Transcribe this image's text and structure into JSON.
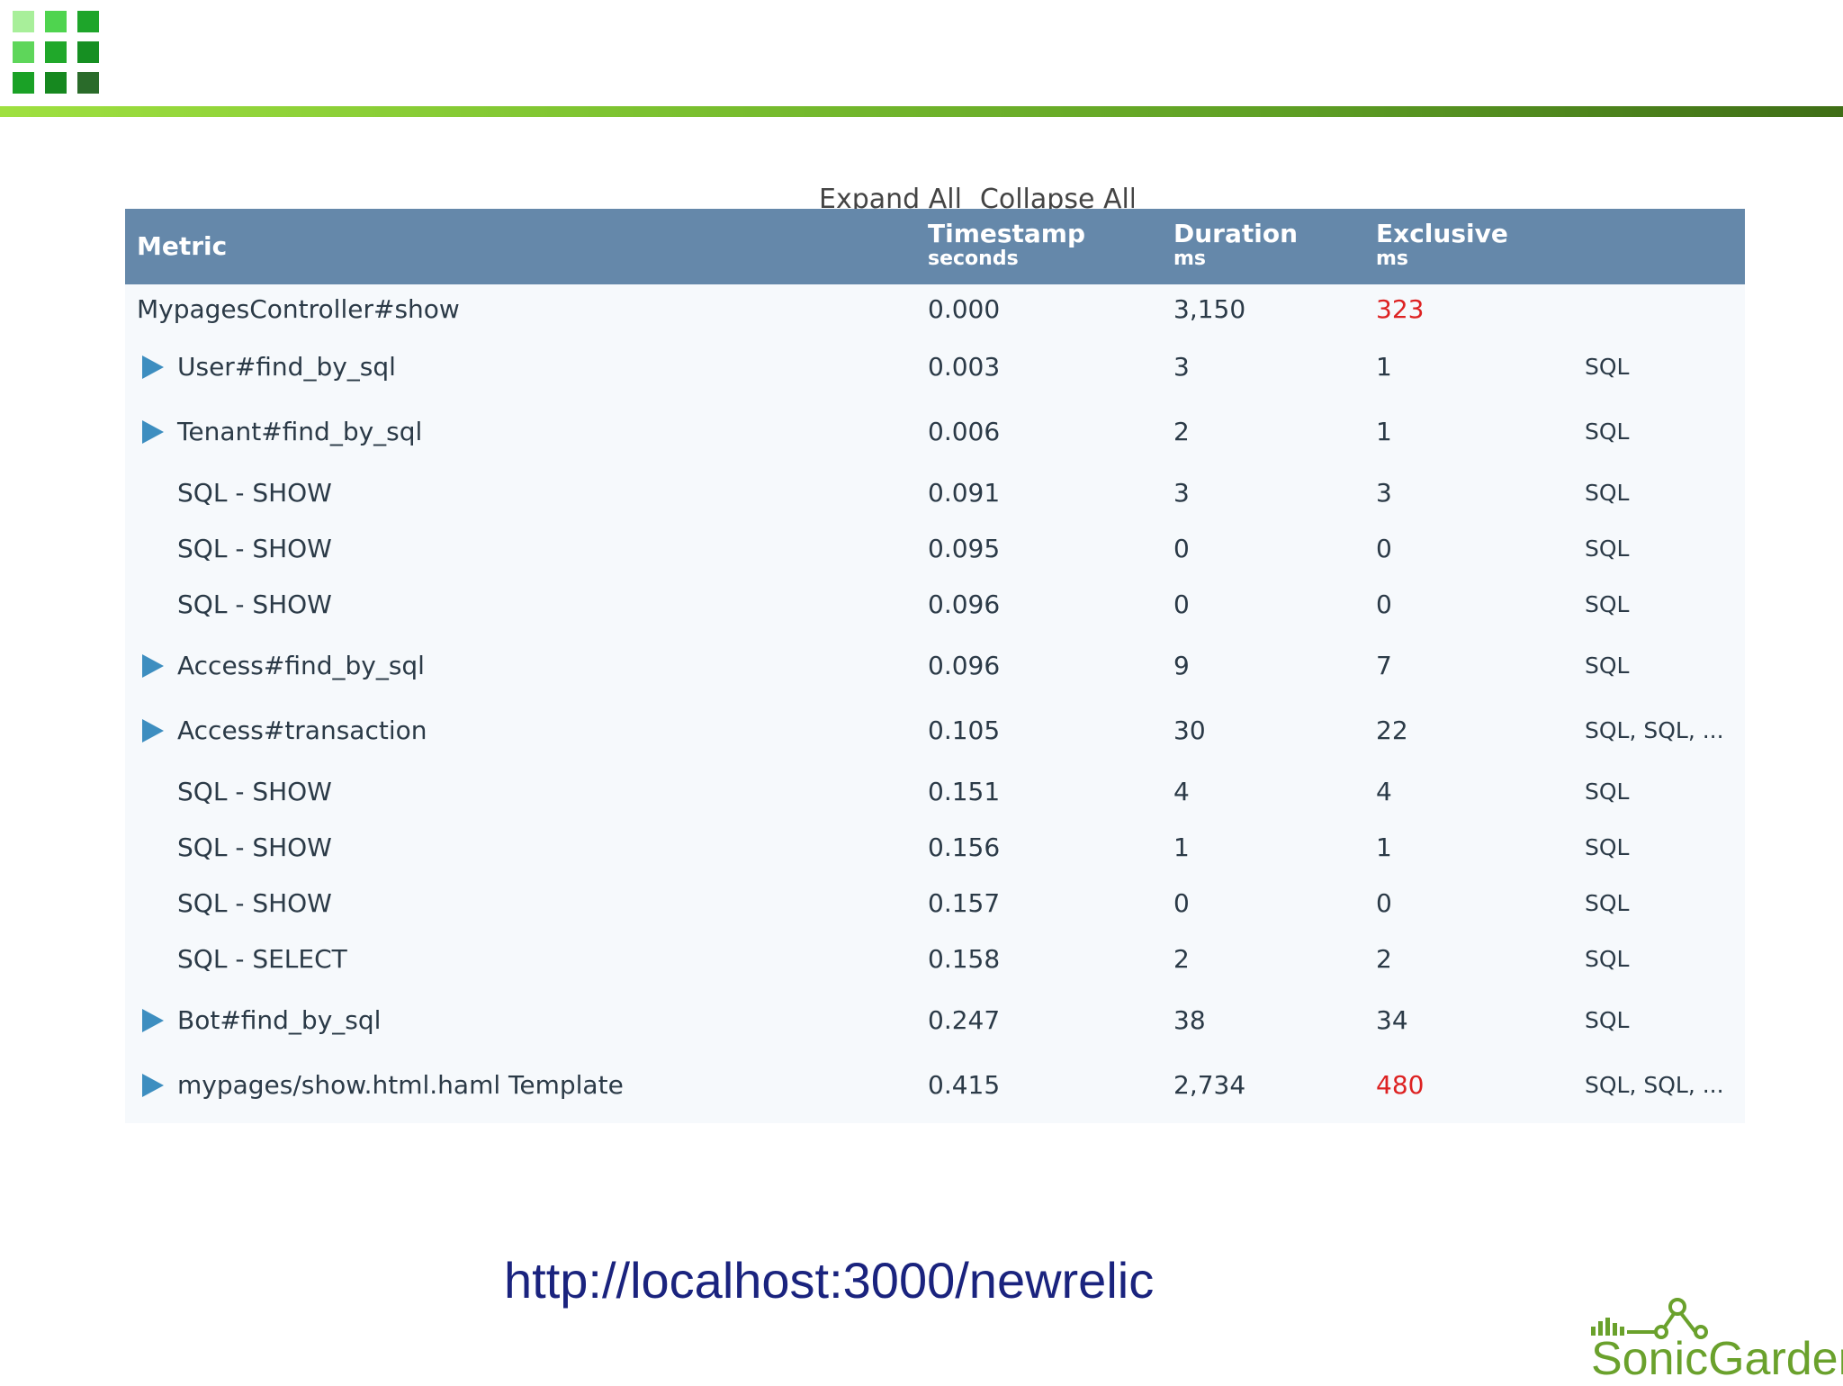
{
  "toolbar": {
    "expand_all": "Expand All",
    "collapse_all": "Collapse All"
  },
  "table": {
    "columns": [
      {
        "label": "Metric",
        "unit": ""
      },
      {
        "label": "Timestamp",
        "unit": "seconds"
      },
      {
        "label": "Duration",
        "unit": "ms"
      },
      {
        "label": "Exclusive",
        "unit": "ms"
      }
    ],
    "rows": [
      {
        "metric": "MypagesController#show",
        "timestamp": "0.000",
        "duration": "3,150",
        "exclusive": "323",
        "detail": "",
        "expandable": false,
        "highlight": true
      },
      {
        "metric": "User#find_by_sql",
        "timestamp": "0.003",
        "duration": "3",
        "exclusive": "1",
        "detail": "SQL",
        "expandable": true,
        "highlight": false
      },
      {
        "metric": "Tenant#find_by_sql",
        "timestamp": "0.006",
        "duration": "2",
        "exclusive": "1",
        "detail": "SQL",
        "expandable": true,
        "highlight": false
      },
      {
        "metric": "SQL - SHOW",
        "timestamp": "0.091",
        "duration": "3",
        "exclusive": "3",
        "detail": "SQL",
        "expandable": false,
        "highlight": false
      },
      {
        "metric": "SQL - SHOW",
        "timestamp": "0.095",
        "duration": "0",
        "exclusive": "0",
        "detail": "SQL",
        "expandable": false,
        "highlight": false
      },
      {
        "metric": "SQL - SHOW",
        "timestamp": "0.096",
        "duration": "0",
        "exclusive": "0",
        "detail": "SQL",
        "expandable": false,
        "highlight": false
      },
      {
        "metric": "Access#find_by_sql",
        "timestamp": "0.096",
        "duration": "9",
        "exclusive": "7",
        "detail": "SQL",
        "expandable": true,
        "highlight": false
      },
      {
        "metric": "Access#transaction",
        "timestamp": "0.105",
        "duration": "30",
        "exclusive": "22",
        "detail": "SQL, SQL, ...",
        "expandable": true,
        "highlight": false
      },
      {
        "metric": "SQL - SHOW",
        "timestamp": "0.151",
        "duration": "4",
        "exclusive": "4",
        "detail": "SQL",
        "expandable": false,
        "highlight": false
      },
      {
        "metric": "SQL - SHOW",
        "timestamp": "0.156",
        "duration": "1",
        "exclusive": "1",
        "detail": "SQL",
        "expandable": false,
        "highlight": false
      },
      {
        "metric": "SQL - SHOW",
        "timestamp": "0.157",
        "duration": "0",
        "exclusive": "0",
        "detail": "SQL",
        "expandable": false,
        "highlight": false
      },
      {
        "metric": "SQL - SELECT",
        "timestamp": "0.158",
        "duration": "2",
        "exclusive": "2",
        "detail": "SQL",
        "expandable": false,
        "highlight": false
      },
      {
        "metric": "Bot#find_by_sql",
        "timestamp": "0.247",
        "duration": "38",
        "exclusive": "34",
        "detail": "SQL",
        "expandable": true,
        "highlight": false
      },
      {
        "metric": "mypages/show.html.haml Template",
        "timestamp": "0.415",
        "duration": "2,734",
        "exclusive": "480",
        "detail": "SQL, SQL, ...",
        "expandable": true,
        "highlight": true
      }
    ]
  },
  "footer": {
    "url": "http://localhost:3000/newrelic",
    "brand": "SonicGarden"
  },
  "colors": {
    "header_bg": "#6588aa",
    "highlight": "#dd2222",
    "caret": "#3d8ec0",
    "url": "#1a237e",
    "brand": "#6aa12c",
    "rule_start": "#9fe040",
    "rule_end": "#3f6e16"
  },
  "icons": {
    "logo": "green-grid-logo-icon",
    "expand": "triangle-right-icon",
    "brand": "signal-node-icon"
  }
}
